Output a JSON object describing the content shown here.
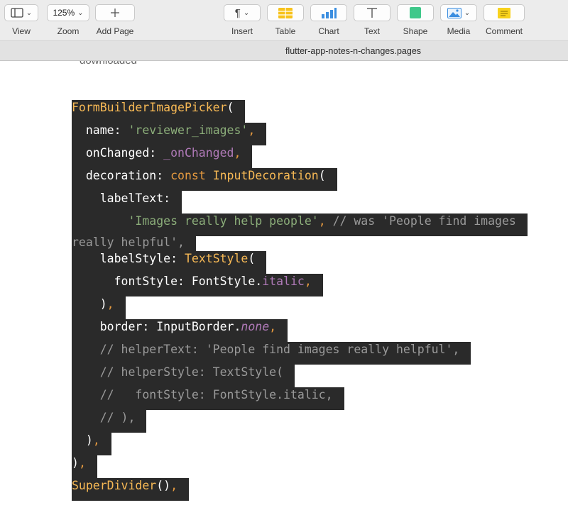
{
  "toolbar": {
    "view_label": "View",
    "zoom_value": "125%",
    "zoom_label": "Zoom",
    "add_page_label": "Add Page",
    "insert_label": "Insert",
    "table_label": "Table",
    "chart_label": "Chart",
    "text_label": "Text",
    "shape_label": "Shape",
    "media_label": "Media",
    "comment_label": "Comment",
    "accent_table": "#f7c21a",
    "accent_chart": "#3b8ee0",
    "accent_shape": "#3fc88a",
    "accent_comment": "#f8d21c"
  },
  "document": {
    "title": "flutter-app-notes-n-changes.pages",
    "partial_text": "downloaded"
  },
  "code": {
    "l1_a": "FormBuilderImagePicker",
    "l1_b": "(",
    "l2_a": "  name: ",
    "l2_b": "'reviewer_images'",
    "l2_c": ",",
    "l3_a": "  onChanged: ",
    "l3_b": "_onChanged",
    "l3_c": ",",
    "l4_a": "  decoration: ",
    "l4_b": "const ",
    "l4_c": "InputDecoration",
    "l4_d": "(",
    "l5_a": "    labelText:",
    "l6_a": "        ",
    "l6_b": "'Images really help people'",
    "l6_c": ",",
    "l6_d": " // was 'People find images",
    "l6_e": "really helpful',",
    "l7_a": "    labelStyle: ",
    "l7_b": "TextStyle",
    "l7_c": "(",
    "l8_a": "      fontStyle: FontStyle.",
    "l8_b": "italic",
    "l8_c": ",",
    "l9_a": "    )",
    "l9_b": ",",
    "l10_a": "    border: InputBorder.",
    "l10_b": "none",
    "l10_c": ",",
    "l11_a": "    // helperText: 'People find images really helpful',",
    "l12_a": "    // helperStyle: TextStyle(",
    "l13_a": "    //   fontStyle: FontStyle.italic,",
    "l14_a": "    // ),",
    "l15_a": "  )",
    "l15_b": ",",
    "l16_a": ")",
    "l16_b": ",",
    "l17_a": "SuperDivider",
    "l17_b": "()",
    "l17_c": ","
  }
}
